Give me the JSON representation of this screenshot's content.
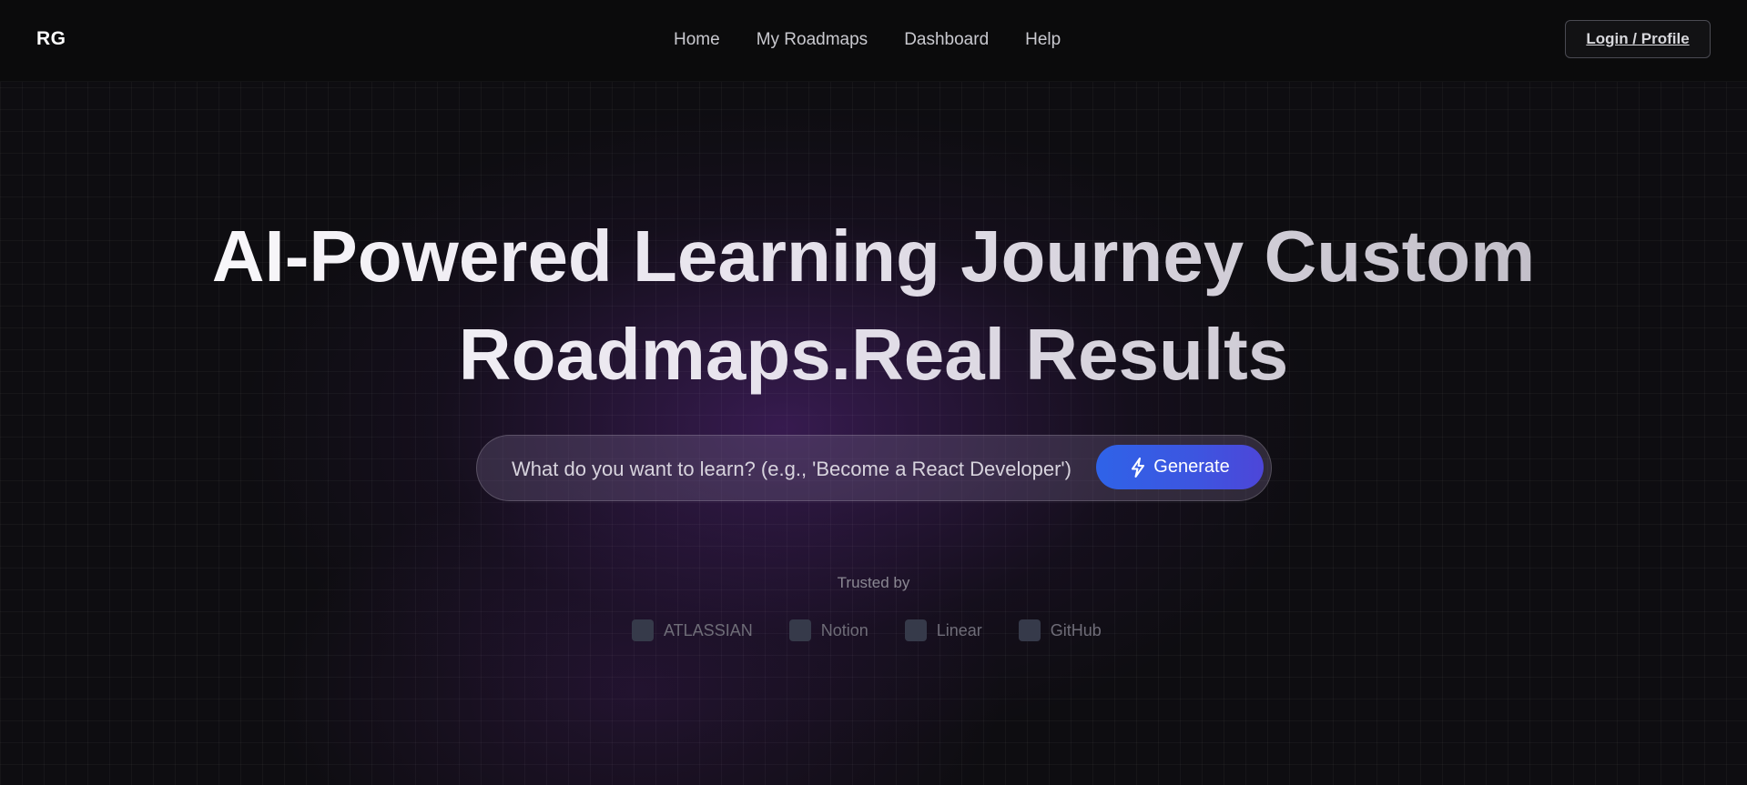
{
  "navbar": {
    "logo": "RG",
    "links": [
      "Home",
      "My Roadmaps",
      "Dashboard",
      "Help"
    ],
    "login_label": "Login / Profile"
  },
  "hero": {
    "title_line1": "AI-Powered Learning Journey Custom",
    "title_line2": "Roadmaps.Real Results"
  },
  "search": {
    "placeholder": "What do you want to learn? (e.g., 'Become a React Developer')",
    "value": "",
    "button_label": "Generate",
    "button_icon": "lightning-bolt-icon"
  },
  "trusted": {
    "label": "Trusted by",
    "brands": [
      "ATLASSIAN",
      "Notion",
      "Linear",
      "GitHub"
    ]
  },
  "colors": {
    "background": "#0e0d11",
    "accent_blue": "#2f63e8",
    "accent_purple": "#4d46d8",
    "glow": "#582682"
  }
}
